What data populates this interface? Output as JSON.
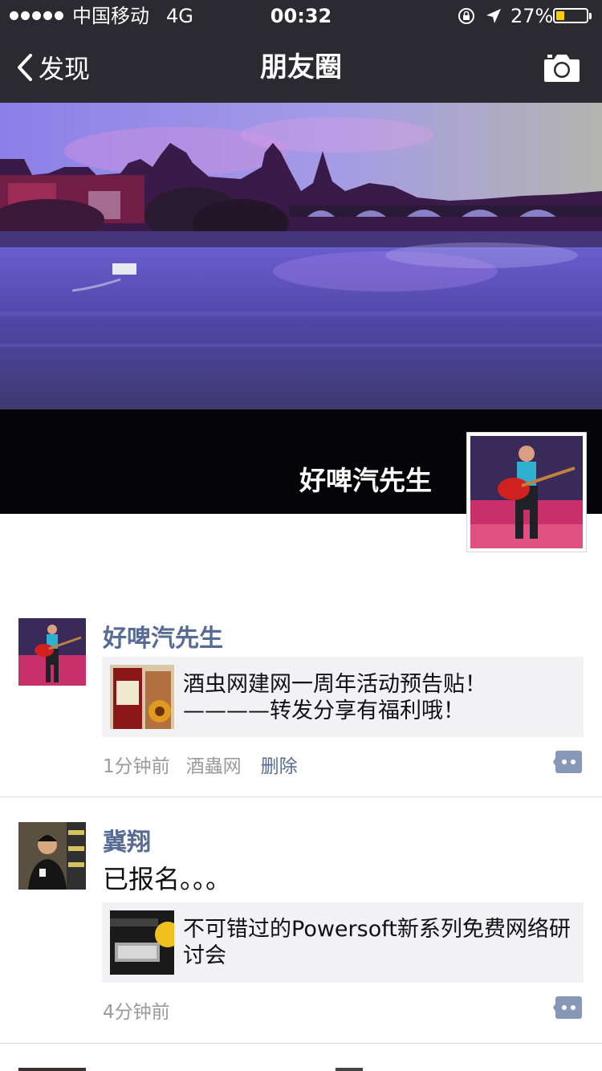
{
  "status_bar": {
    "carrier": "中国移动",
    "network": "4G",
    "time": "00:32",
    "battery": "27%",
    "battery_level": 0.27,
    "icons": [
      "signal-dots-icon",
      "orientation-lock-icon",
      "location-arrow-icon",
      "battery-icon"
    ]
  },
  "nav": {
    "back_label": "发现",
    "title": "朋友圈",
    "right_icon": "camera-icon"
  },
  "profile": {
    "name": "好啤汽先生"
  },
  "posts": [
    {
      "author": "好啤汽先生",
      "text": "",
      "link_title": "酒虫网建网一周年活动预告贴！————转发分享有福利哦！",
      "time": "1分钟前",
      "source": "酒蟲网",
      "delete_label": "删除"
    },
    {
      "author": "冀翔",
      "text": "已报名。。。",
      "link_title": "不可错过的Powersoft新系列免费网络研讨会",
      "time": "4分钟前",
      "source": "",
      "delete_label": ""
    }
  ],
  "colors": {
    "nav_bg": "#2b2a30",
    "link_blue": "#576b95",
    "card_bg": "#f2f2f4",
    "battery_yellow": "#ffcc00"
  }
}
